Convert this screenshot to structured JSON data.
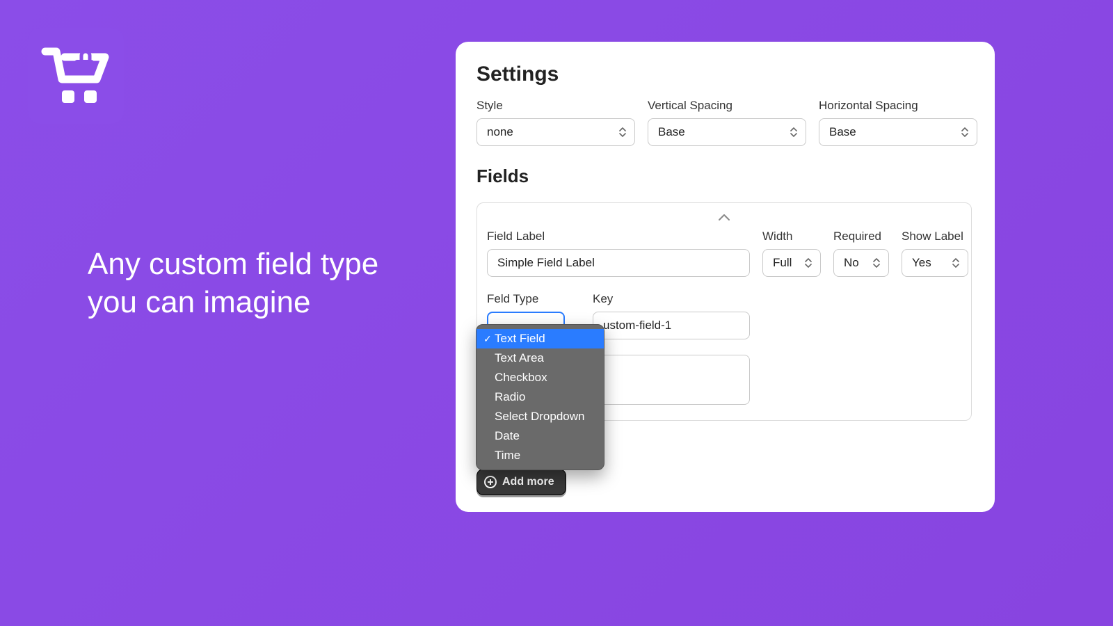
{
  "headline_line1": "Any custom field type",
  "headline_line2": "you can imagine",
  "settings": {
    "title": "Settings",
    "style_label": "Style",
    "style_value": "none",
    "vspacing_label": "Vertical Spacing",
    "vspacing_value": "Base",
    "hspacing_label": "Horizontal Spacing",
    "hspacing_value": "Base"
  },
  "fields": {
    "title": "Fields",
    "field_label_label": "Field Label",
    "field_label_value": "Simple Field Label",
    "width_label": "Width",
    "width_value": "Full",
    "required_label": "Required",
    "required_value": "No",
    "show_label_label": "Show Label",
    "show_label_value": "Yes",
    "field_type_label": "Feld Type",
    "key_label": "Key",
    "key_value": "ustom-field-1",
    "add_more_label": "Add more"
  },
  "field_type_options": {
    "opt0": "Text Field",
    "opt1": "Text Area",
    "opt2": "Checkbox",
    "opt3": "Radio",
    "opt4": "Select Dropdown",
    "opt5": "Date",
    "opt6": "Time"
  }
}
